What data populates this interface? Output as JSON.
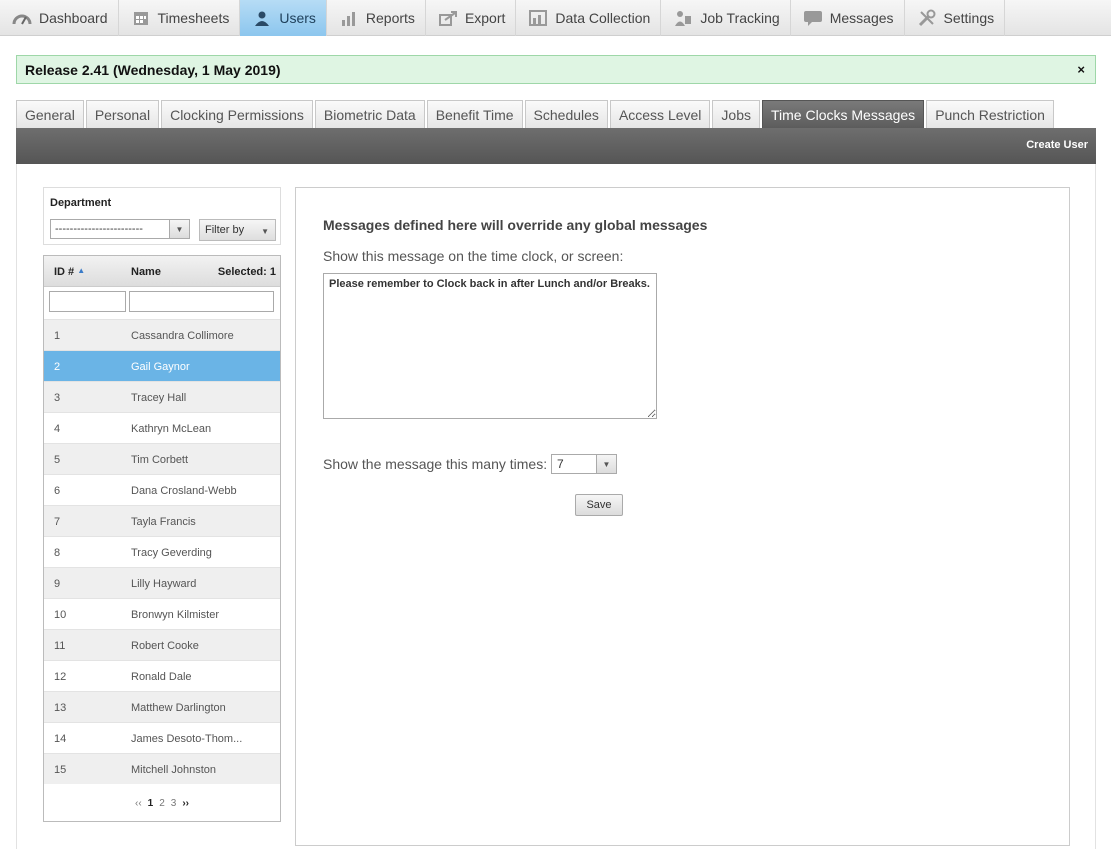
{
  "nav": {
    "items": [
      {
        "label": "Dashboard",
        "icon": "dashboard-icon"
      },
      {
        "label": "Timesheets",
        "icon": "calendar-icon"
      },
      {
        "label": "Users",
        "icon": "user-icon"
      },
      {
        "label": "Reports",
        "icon": "bar-chart-icon"
      },
      {
        "label": "Export",
        "icon": "export-icon"
      },
      {
        "label": "Data Collection",
        "icon": "data-collection-icon"
      },
      {
        "label": "Job Tracking",
        "icon": "job-tracking-icon"
      },
      {
        "label": "Messages",
        "icon": "speech-bubble-icon"
      },
      {
        "label": "Settings",
        "icon": "wrench-icon"
      }
    ],
    "active": "Users"
  },
  "banner": {
    "text": "Release 2.41 (Wednesday, 1 May 2019)",
    "close": "×"
  },
  "tabs": [
    "General",
    "Personal",
    "Clocking Permissions",
    "Biometric Data",
    "Benefit Time",
    "Schedules",
    "Access Level",
    "Jobs",
    "Time Clocks Messages",
    "Punch Restriction"
  ],
  "active_tab": "Time Clocks Messages",
  "toolbar": {
    "create_user": "Create User"
  },
  "department": {
    "label": "Department",
    "value": "------------------------",
    "filter_label": "Filter by"
  },
  "user_table": {
    "col_id": "ID #",
    "col_name": "Name",
    "selected": "Selected: 1",
    "rows": [
      {
        "id": "1",
        "name": "Cassandra Collimore"
      },
      {
        "id": "2",
        "name": "Gail Gaynor"
      },
      {
        "id": "3",
        "name": "Tracey Hall"
      },
      {
        "id": "4",
        "name": "Kathryn McLean"
      },
      {
        "id": "5",
        "name": "Tim Corbett"
      },
      {
        "id": "6",
        "name": "Dana Crosland-Webb"
      },
      {
        "id": "7",
        "name": "Tayla Francis"
      },
      {
        "id": "8",
        "name": "Tracy Geverding"
      },
      {
        "id": "9",
        "name": "Lilly Hayward"
      },
      {
        "id": "10",
        "name": "Bronwyn Kilmister"
      },
      {
        "id": "11",
        "name": "Robert Cooke"
      },
      {
        "id": "12",
        "name": "Ronald Dale"
      },
      {
        "id": "13",
        "name": "Matthew Darlington"
      },
      {
        "id": "14",
        "name": "James Desoto-Thom..."
      },
      {
        "id": "15",
        "name": "Mitchell Johnston"
      }
    ],
    "selected_id": "2",
    "pager": {
      "prev": "‹‹",
      "pages": [
        "1",
        "2",
        "3"
      ],
      "current": "1",
      "next": "››"
    }
  },
  "message": {
    "title": "Messages defined here will override any global messages",
    "show_label": "Show this message on the time clock, or screen:",
    "text": "Please remember to Clock back in after Lunch and/or Breaks.",
    "times_label": "Show the message this many times:",
    "times_value": "7",
    "save_label": "Save"
  },
  "colors": {
    "active_nav": "#8cc6ee",
    "selected_row": "#6ab4e6",
    "banner_bg": "#dff5e3"
  }
}
